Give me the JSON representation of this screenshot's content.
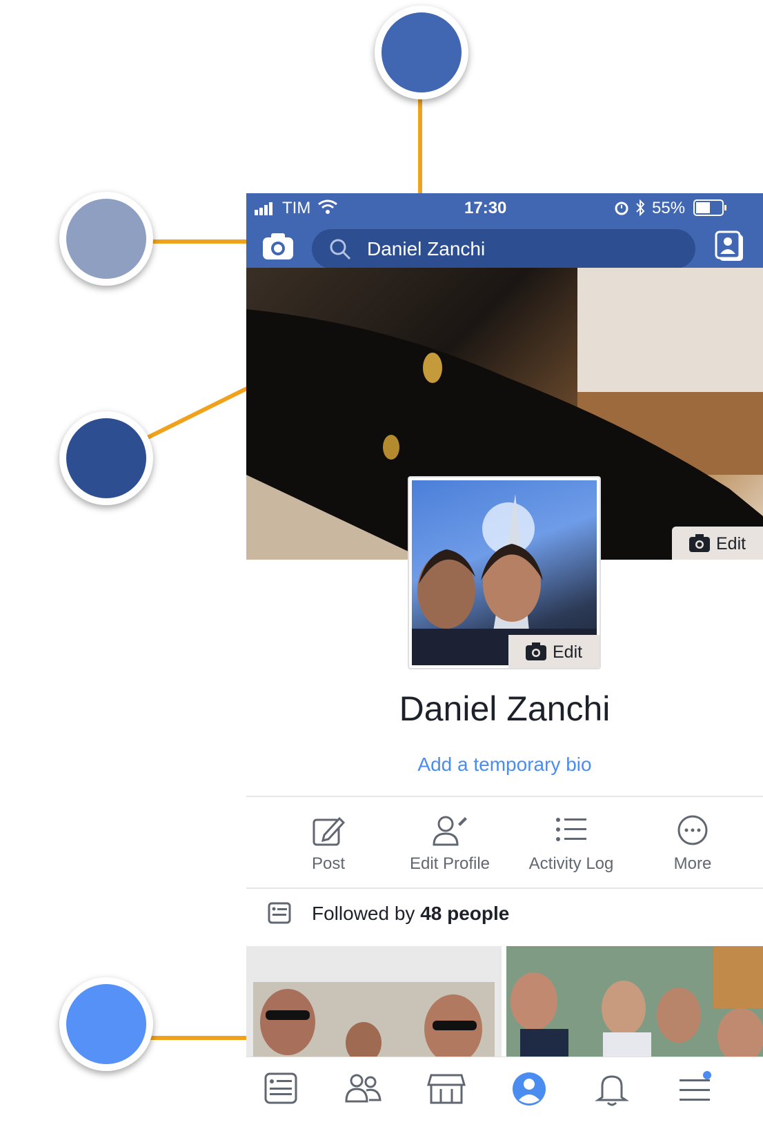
{
  "status": {
    "carrier": "TIM",
    "time": "17:30",
    "battery": "55%"
  },
  "search": {
    "value": "Daniel Zanchi"
  },
  "cover": {
    "edit_label": "Edit"
  },
  "avatar": {
    "edit_label": "Edit"
  },
  "profile": {
    "name": "Daniel Zanchi",
    "bio_link": "Add a temporary bio"
  },
  "actions": [
    {
      "label": "Post",
      "icon": "compose-icon"
    },
    {
      "label": "Edit Profile",
      "icon": "edit-person-icon"
    },
    {
      "label": "Activity Log",
      "icon": "list-icon"
    },
    {
      "label": "More",
      "icon": "more-dots-icon"
    }
  ],
  "followed": {
    "prefix": "Followed by ",
    "count": "48 people"
  },
  "tabs": [
    "news-feed-icon",
    "friends-icon",
    "marketplace-icon",
    "profile-icon",
    "notifications-icon",
    "menu-icon"
  ],
  "colors": {
    "brand": "#4267b2",
    "search_bg": "#2d4e91",
    "link": "#4a8cf0",
    "annotation_line": "#f0a21c",
    "marker_top": "#4267b2",
    "marker_left_top": "#8e9fc2",
    "marker_left_mid": "#2d4e91",
    "marker_bottom": "#5591f6"
  }
}
